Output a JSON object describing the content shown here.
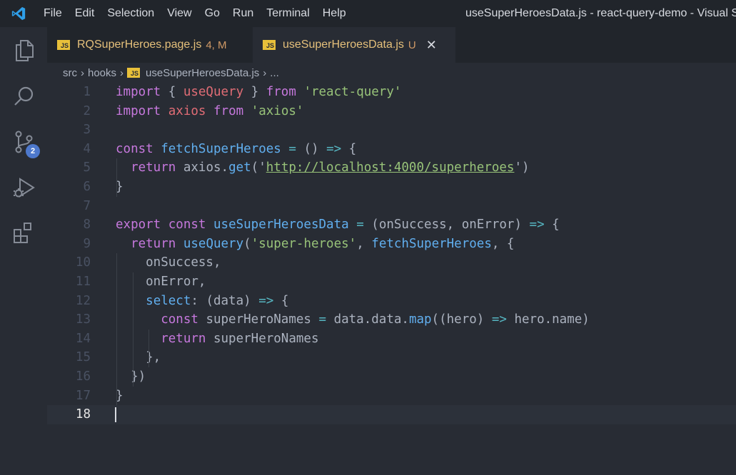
{
  "menu": {
    "items": [
      "File",
      "Edit",
      "Selection",
      "View",
      "Go",
      "Run",
      "Terminal",
      "Help"
    ]
  },
  "window": {
    "title": "useSuperHeroesData.js - react-query-demo - Visual St"
  },
  "activity_bar": {
    "icons": [
      "explorer-icon",
      "search-icon",
      "source-control-icon",
      "run-debug-icon",
      "extensions-icon"
    ],
    "source_control_badge": "2"
  },
  "tabs": [
    {
      "icon_text": "JS",
      "name": "RQSuperHeroes.page.js",
      "status": "4, M",
      "active": false
    },
    {
      "icon_text": "JS",
      "name": "useSuperHeroesData.js",
      "status": "U",
      "active": true,
      "close": "✕"
    }
  ],
  "breadcrumb": {
    "parts": [
      "src",
      "hooks",
      "useSuperHeroesData.js",
      "..."
    ],
    "separator": "›",
    "file_icon_text": "JS"
  },
  "editor": {
    "current_line": 18,
    "lines": [
      {
        "n": "1",
        "tokens": [
          [
            "kw",
            "import"
          ],
          [
            "pl",
            " { "
          ],
          [
            "var",
            "useQuery"
          ],
          [
            "pl",
            " } "
          ],
          [
            "kw",
            "from"
          ],
          [
            "pl",
            " "
          ],
          [
            "str",
            "'react-query'"
          ]
        ]
      },
      {
        "n": "2",
        "tokens": [
          [
            "kw",
            "import"
          ],
          [
            "pl",
            " "
          ],
          [
            "var",
            "axios"
          ],
          [
            "pl",
            " "
          ],
          [
            "kw",
            "from"
          ],
          [
            "pl",
            " "
          ],
          [
            "str",
            "'axios'"
          ]
        ]
      },
      {
        "n": "3",
        "tokens": []
      },
      {
        "n": "4",
        "tokens": [
          [
            "kw",
            "const"
          ],
          [
            "pl",
            " "
          ],
          [
            "fn",
            "fetchSuperHeroes"
          ],
          [
            "pl",
            " "
          ],
          [
            "op",
            "="
          ],
          [
            "pl",
            " () "
          ],
          [
            "op",
            "=>"
          ],
          [
            "pl",
            " {"
          ]
        ]
      },
      {
        "n": "5",
        "tokens": [
          [
            "pl",
            "  "
          ],
          [
            "kw",
            "return"
          ],
          [
            "pl",
            " axios."
          ],
          [
            "fn",
            "get"
          ],
          [
            "pl",
            "('"
          ],
          [
            "url",
            "http://localhost:4000/superheroes"
          ],
          [
            "pl",
            "')"
          ]
        ]
      },
      {
        "n": "6",
        "tokens": [
          [
            "pl",
            "}"
          ]
        ]
      },
      {
        "n": "7",
        "tokens": []
      },
      {
        "n": "8",
        "tokens": [
          [
            "kw",
            "export"
          ],
          [
            "pl",
            " "
          ],
          [
            "kw",
            "const"
          ],
          [
            "pl",
            " "
          ],
          [
            "fn",
            "useSuperHeroesData"
          ],
          [
            "pl",
            " "
          ],
          [
            "op",
            "="
          ],
          [
            "pl",
            " (onSuccess, onError) "
          ],
          [
            "op",
            "=>"
          ],
          [
            "pl",
            " {"
          ]
        ]
      },
      {
        "n": "9",
        "tokens": [
          [
            "pl",
            "  "
          ],
          [
            "kw",
            "return"
          ],
          [
            "pl",
            " "
          ],
          [
            "fn",
            "useQuery"
          ],
          [
            "pl",
            "("
          ],
          [
            "str",
            "'super-heroes'"
          ],
          [
            "pl",
            ", "
          ],
          [
            "fn",
            "fetchSuperHeroes"
          ],
          [
            "pl",
            ", {"
          ]
        ]
      },
      {
        "n": "10",
        "tokens": [
          [
            "pl",
            "    onSuccess,"
          ]
        ]
      },
      {
        "n": "11",
        "tokens": [
          [
            "pl",
            "    onError,"
          ]
        ]
      },
      {
        "n": "12",
        "tokens": [
          [
            "pl",
            "    "
          ],
          [
            "fn",
            "select"
          ],
          [
            "pl",
            ": (data) "
          ],
          [
            "op",
            "=>"
          ],
          [
            "pl",
            " {"
          ]
        ]
      },
      {
        "n": "13",
        "tokens": [
          [
            "pl",
            "      "
          ],
          [
            "kw",
            "const"
          ],
          [
            "pl",
            " superHeroNames "
          ],
          [
            "op",
            "="
          ],
          [
            "pl",
            " data.data."
          ],
          [
            "fn",
            "map"
          ],
          [
            "pl",
            "((hero) "
          ],
          [
            "op",
            "=>"
          ],
          [
            "pl",
            " hero.name)"
          ]
        ]
      },
      {
        "n": "14",
        "tokens": [
          [
            "pl",
            "      "
          ],
          [
            "kw",
            "return"
          ],
          [
            "pl",
            " superHeroNames"
          ]
        ]
      },
      {
        "n": "15",
        "tokens": [
          [
            "pl",
            "    },"
          ]
        ]
      },
      {
        "n": "16",
        "tokens": [
          [
            "pl",
            "  })"
          ]
        ]
      },
      {
        "n": "17",
        "tokens": [
          [
            "pl",
            "}"
          ]
        ]
      },
      {
        "n": "18",
        "tokens": []
      }
    ]
  }
}
